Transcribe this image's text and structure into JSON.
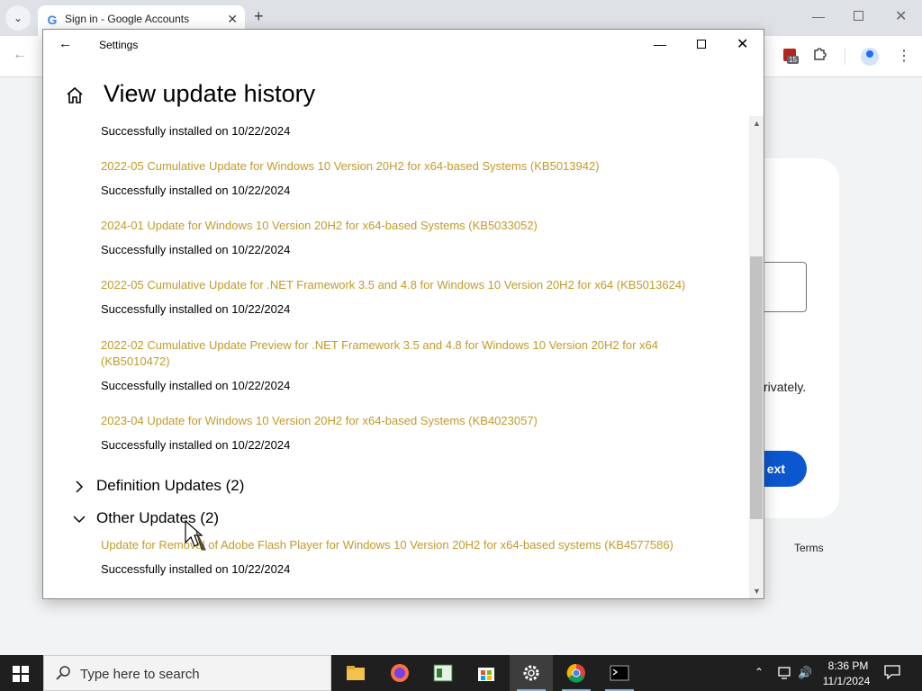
{
  "browser": {
    "tab_title": "Sign in - Google Accounts",
    "g_letter": "G",
    "extension_badge_count": "15",
    "page_text_fragment": "rivately.",
    "next_label": "Next",
    "terms_label": "Terms"
  },
  "settings": {
    "window_title": "Settings",
    "page_title": "View update history",
    "top_status": "Successfully installed on 10/22/2024",
    "updates": [
      {
        "name": "2022-05 Cumulative Update for Windows 10 Version 20H2 for x64-based Systems (KB5013942)",
        "status": "Successfully installed on 10/22/2024"
      },
      {
        "name": "2024-01 Update for Windows 10 Version 20H2 for x64-based Systems (KB5033052)",
        "status": "Successfully installed on 10/22/2024"
      },
      {
        "name": "2022-05 Cumulative Update for .NET Framework 3.5 and 4.8 for Windows 10 Version 20H2 for x64 (KB5013624)",
        "status": "Successfully installed on 10/22/2024"
      },
      {
        "name": "2022-02 Cumulative Update Preview for .NET Framework 3.5 and 4.8 for Windows 10 Version 20H2 for x64 (KB5010472)",
        "status": "Successfully installed on 10/22/2024"
      },
      {
        "name": "2023-04 Update for Windows 10 Version 20H2 for x64-based Systems (KB4023057)",
        "status": "Successfully installed on 10/22/2024"
      }
    ],
    "definition_section": "Definition Updates (2)",
    "other_section": "Other Updates (2)",
    "other_updates": [
      {
        "name": "Update for Removal of Adobe Flash Player for Windows 10 Version 20H2 for x64-based systems (KB4577586)",
        "status": "Successfully installed on 10/22/2024"
      }
    ],
    "link_color": "#c19a2b"
  },
  "taskbar": {
    "search_placeholder": "Type here to search",
    "time": "8:36 PM",
    "date": "11/1/2024",
    "apps": [
      "file-explorer",
      "firefox",
      "notepad-app",
      "microsoft-store",
      "settings",
      "chrome",
      "terminal"
    ]
  }
}
